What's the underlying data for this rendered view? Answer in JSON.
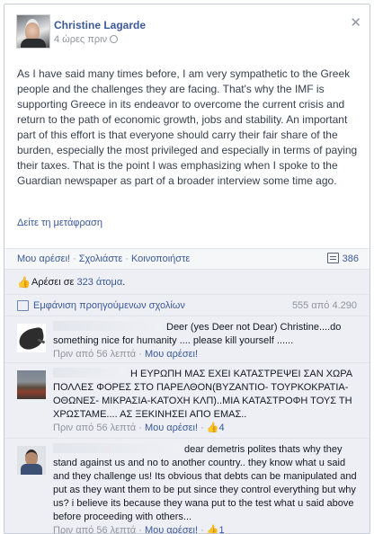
{
  "post": {
    "author": "Christine Lagarde",
    "timestamp": "4 ώρες πριν",
    "close_symbol": "✕",
    "text": "As I have said many times before, I am very sympathetic to the Greek people and the challenges they are facing. That's why the IMF is supporting Greece in its endeavor to overcome the current crisis and return to the path of economic growth, jobs and stability. An important part of this effort is that everyone should carry their fair share of the burden, especially the most privileged and especially in terms of paying their taxes. That is the point I was emphasizing when I spoke to the Guardian newspaper as part of a broader interview some time ago.",
    "translate_link": "Δείτε τη μετάφραση"
  },
  "actions": {
    "like": "Μου αρέσει!",
    "comment": "Σχολιάστε",
    "share": "Κοινοποιήστε",
    "separator": "·",
    "comment_count": "386",
    "comment_icon": "speech-bubble-icon"
  },
  "likes": {
    "prefix": "Αρέσει σε ",
    "count_link": "323 άτομα",
    "suffix": ".",
    "icon": "thumbs-up-icon"
  },
  "previous_comments": {
    "label": "Εμφάνιση προηγούμενων σχολίων",
    "count": "555 από 4.290"
  },
  "comments": [
    {
      "text": "Deer (yes Deer not Dear) Christine....do something nice for humanity .... please kill yourself ......",
      "time": "Πριν από 56 λεπτά",
      "like": "Μου αρέσει!",
      "likes": "",
      "avatar_icon": "bird-avatar"
    },
    {
      "text": "Η ΕΥΡΩΠΗ ΜΑΣ ΕΧΕΙ ΚΑΤΑΣΤΡΕΨΕΙ ΣΑΝ ΧΩΡΑ ΠΟΛΛΕΣ ΦΟΡΕΣ ΣΤΟ ΠΑΡΕΛΘΟΝ(ΒΥΖΑΝΤΙΟ- ΤΟΥΡΚΟΚΡΑΤΙΑ- ΟΘΩΝΕΣ- ΜΙΚΡΑΣΙΑ-ΚΑΤΟΧΗ ΚΛΠ)..ΜΙΑ ΚΑΤΑΣΤΡΟΦΗ ΤΟΥΣ ΤΗ ΧΡΩΣΤΑΜΕ.... ΑΣ ΞΕΚΙΝΗΣΕΙ ΑΠΟ ΕΜΑΣ..",
      "time": "Πριν από 56 λεπτά",
      "like": "Μου αρέσει!",
      "likes": "4",
      "avatar_icon": "landscape-avatar"
    },
    {
      "text": "dear demetris polites thats why they stand against us and no to another country.. they know what u said and they challenge us! Its obvious that debts can be manipulated and put as they want them to be put since they control everything but why us? i believe its because they wana put to the test what u said above before proceeding with others...",
      "time": "Πριν από 56 λεπτά",
      "like": "Μου αρέσει!",
      "likes": "1",
      "avatar_icon": "person-avatar"
    }
  ]
}
